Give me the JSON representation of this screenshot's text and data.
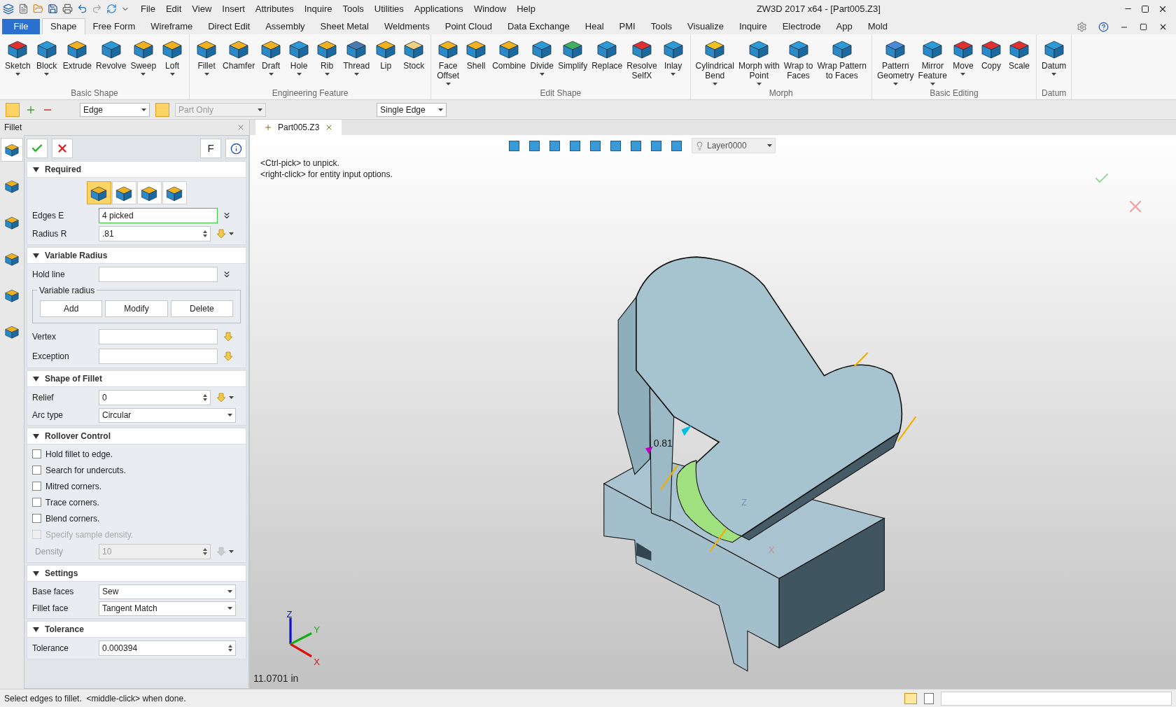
{
  "title_bar": {
    "menu": [
      "File",
      "Edit",
      "View",
      "Insert",
      "Attributes",
      "Inquire",
      "Tools",
      "Utilities",
      "Applications",
      "Window",
      "Help"
    ],
    "title": "ZW3D 2017  x64 - [Part005.Z3]"
  },
  "file_button": "File",
  "ribbon_tabs": [
    {
      "label": "Shape",
      "selected": true
    },
    {
      "label": "Free Form",
      "selected": false
    },
    {
      "label": "Wireframe",
      "selected": false
    },
    {
      "label": "Direct Edit",
      "selected": false
    },
    {
      "label": "Assembly",
      "selected": false
    },
    {
      "label": "Sheet Metal",
      "selected": false
    },
    {
      "label": "Weldments",
      "selected": false
    },
    {
      "label": "Point Cloud",
      "selected": false
    },
    {
      "label": "Data Exchange",
      "selected": false
    },
    {
      "label": "Heal",
      "selected": false
    },
    {
      "label": "PMI",
      "selected": false
    },
    {
      "label": "Tools",
      "selected": false
    },
    {
      "label": "Visualize",
      "selected": false
    },
    {
      "label": "Inquire",
      "selected": false
    },
    {
      "label": "Electrode",
      "selected": false
    },
    {
      "label": "App",
      "selected": false
    },
    {
      "label": "Mold",
      "selected": false
    }
  ],
  "ribbon_groups": [
    {
      "title": "Basic Shape",
      "tools": [
        {
          "label": "Sketch",
          "dropdown": true,
          "color": "#e03030"
        },
        {
          "label": "Block",
          "dropdown": true,
          "color": "#2a9ad8"
        },
        {
          "label": "Extrude",
          "dropdown": false,
          "color": "#f0b020"
        },
        {
          "label": "Revolve",
          "dropdown": false,
          "color": "#2a9ad8"
        },
        {
          "label": "Sweep",
          "dropdown": true,
          "color": "#f0b020"
        },
        {
          "label": "Loft",
          "dropdown": true,
          "color": "#f0b020"
        }
      ]
    },
    {
      "title": "Engineering Feature",
      "tools": [
        {
          "label": "Fillet",
          "dropdown": true,
          "color": "#f0b020"
        },
        {
          "label": "Chamfer",
          "dropdown": false,
          "color": "#f0b020"
        },
        {
          "label": "Draft",
          "dropdown": true,
          "color": "#f0b020"
        },
        {
          "label": "Hole",
          "dropdown": true,
          "color": "#2a9ad8"
        },
        {
          "label": "Rib",
          "dropdown": true,
          "color": "#f0b020"
        },
        {
          "label": "Thread",
          "dropdown": true,
          "color": "#4a7ab0"
        },
        {
          "label": "Lip",
          "dropdown": false,
          "color": "#f0b020"
        },
        {
          "label": "Stock",
          "dropdown": false,
          "color": "#f0d080"
        }
      ]
    },
    {
      "title": "Edit Shape",
      "tools": [
        {
          "label": "Face\nOffset",
          "dropdown": true,
          "color": "#f0b020"
        },
        {
          "label": "Shell",
          "dropdown": false,
          "color": "#f0b020"
        },
        {
          "label": "Combine",
          "dropdown": false,
          "color": "#f0b020"
        },
        {
          "label": "Divide",
          "dropdown": true,
          "color": "#2a9ad8"
        },
        {
          "label": "Simplify",
          "dropdown": false,
          "color": "#40b060"
        },
        {
          "label": "Replace",
          "dropdown": false,
          "color": "#2a9ad8"
        },
        {
          "label": "Resolve\nSelfX",
          "dropdown": false,
          "color": "#e03030"
        },
        {
          "label": "Inlay",
          "dropdown": true,
          "color": "#2a9ad8"
        }
      ]
    },
    {
      "title": "Morph",
      "tools": [
        {
          "label": "Cylindrical\nBend",
          "dropdown": true,
          "color": "#f0c020"
        },
        {
          "label": "Morph with\nPoint",
          "dropdown": true,
          "color": "#2a9ad8"
        },
        {
          "label": "Wrap to\nFaces",
          "dropdown": false,
          "color": "#2a9ad8"
        },
        {
          "label": "Wrap Pattern\nto Faces",
          "dropdown": false,
          "color": "#2a9ad8"
        }
      ]
    },
    {
      "title": "Basic Editing",
      "tools": [
        {
          "label": "Pattern\nGeometry",
          "dropdown": true,
          "color": "#4a8ad8"
        },
        {
          "label": "Mirror\nFeature",
          "dropdown": true,
          "color": "#2a9ad8"
        },
        {
          "label": "Move",
          "dropdown": true,
          "color": "#e03030"
        },
        {
          "label": "Copy",
          "dropdown": false,
          "color": "#e03030"
        },
        {
          "label": "Scale",
          "dropdown": false,
          "color": "#e03030"
        }
      ]
    },
    {
      "title": "Datum",
      "tools": [
        {
          "label": "Datum",
          "dropdown": true,
          "color": "#2a9ad8"
        }
      ]
    }
  ],
  "toolbar": {
    "filter": "Edge",
    "scope": "Part Only",
    "pick_mode": "Single Edge"
  },
  "panel": {
    "title": "Fillet",
    "sidebar": [
      {
        "selected": true
      },
      {
        "selected": false
      },
      {
        "selected": false
      },
      {
        "selected": false
      },
      {
        "selected": false
      },
      {
        "selected": false
      }
    ],
    "mode_button": "F",
    "sections": [
      {
        "title": "Required",
        "expanded": true,
        "rows": [
          {
            "kind": "types",
            "options": [
              {
                "selected": true
              },
              {
                "selected": false
              },
              {
                "selected": false
              },
              {
                "selected": false
              }
            ]
          },
          {
            "kind": "text",
            "label": "Edges E",
            "value": "4 picked",
            "focused": true
          },
          {
            "kind": "spin",
            "label": "Radius R",
            "value": ".81",
            "disabled": false
          }
        ]
      },
      {
        "title": "Variable Radius",
        "expanded": true,
        "rows": [
          {
            "kind": "text",
            "label": "Hold line",
            "focused": false
          },
          {
            "kind": "group",
            "title": "Variable radius",
            "buttons": [
              "Add",
              "Modify",
              "Delete"
            ]
          },
          {
            "kind": "pick",
            "label": "Vertex"
          },
          {
            "kind": "pick",
            "label": "Exception"
          }
        ]
      },
      {
        "title": "Shape of Fillet",
        "expanded": true,
        "rows": [
          {
            "kind": "spin",
            "label": "Relief",
            "value": "0",
            "disabled": false
          },
          {
            "kind": "select",
            "label": "Arc type",
            "value": "Circular"
          }
        ]
      },
      {
        "title": "Rollover Control",
        "expanded": true,
        "rows": [
          {
            "kind": "check",
            "label": "Hold fillet to edge.",
            "checked": false,
            "disabled": false
          },
          {
            "kind": "check",
            "label": "Search for undercuts.",
            "checked": false,
            "disabled": false
          },
          {
            "kind": "check",
            "label": "Mitred corners.",
            "checked": false,
            "disabled": false
          },
          {
            "kind": "check",
            "label": "Trace corners.",
            "checked": false,
            "disabled": false
          },
          {
            "kind": "check",
            "label": "Blend corners.",
            "checked": false,
            "disabled": false
          },
          {
            "kind": "check",
            "label": "Specify sample density.",
            "checked": false,
            "disabled": true
          },
          {
            "kind": "spin",
            "label": "Density",
            "value": "10",
            "disabled": true
          }
        ]
      },
      {
        "title": "Settings",
        "expanded": true,
        "rows": [
          {
            "kind": "select",
            "label": "Base faces",
            "value": "Sew"
          },
          {
            "kind": "select",
            "label": "Fillet face",
            "value": "Tangent Match"
          }
        ]
      },
      {
        "title": "Tolerance",
        "expanded": true,
        "rows": [
          {
            "kind": "spinonly",
            "label": "Tolerance",
            "value": "0.000394",
            "disabled": false
          }
        ]
      }
    ]
  },
  "document_tab": {
    "label": "Part005.Z3"
  },
  "view_toolbar": {
    "layer": "Layer0000"
  },
  "viewport": {
    "hints": [
      "<Ctrl-pick> to unpick.",
      "<right-click> for entity input options."
    ],
    "dimension": "0.81",
    "model_axes": [
      "Z",
      "X"
    ],
    "axes": [
      "Z",
      "Y",
      "X"
    ],
    "distance": "11.0701 in"
  },
  "status_bar": {
    "message": "Select edges to fillet.  <middle-click> when done."
  }
}
